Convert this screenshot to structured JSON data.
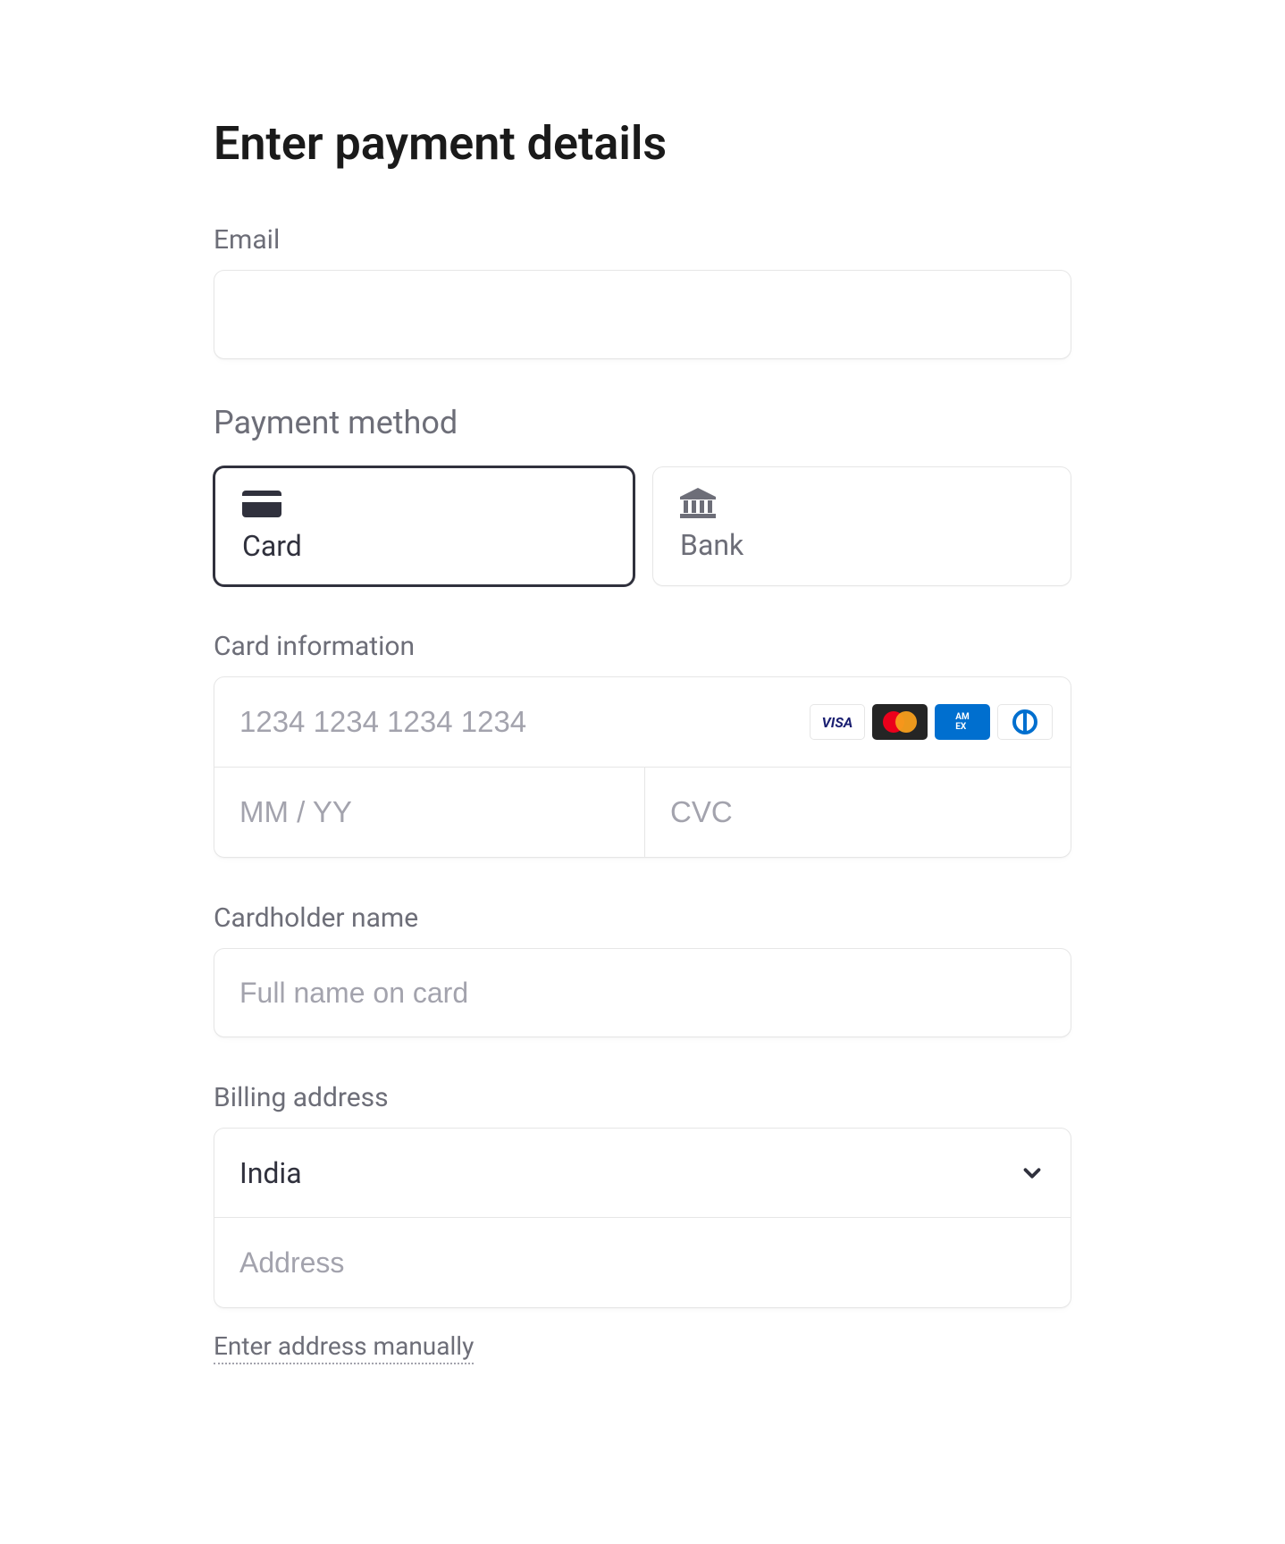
{
  "title": "Enter payment details",
  "email": {
    "label": "Email",
    "value": ""
  },
  "payment_method": {
    "label": "Payment method",
    "options": [
      {
        "id": "card",
        "label": "Card",
        "selected": true
      },
      {
        "id": "bank",
        "label": "Bank",
        "selected": false
      }
    ]
  },
  "card_info": {
    "label": "Card information",
    "number_placeholder": "1234 1234 1234 1234",
    "expiry_placeholder": "MM / YY",
    "cvc_placeholder": "CVC",
    "brands": [
      "visa",
      "mastercard",
      "amex",
      "diners"
    ]
  },
  "cardholder": {
    "label": "Cardholder name",
    "placeholder": "Full name on card"
  },
  "billing": {
    "label": "Billing address",
    "country": "India",
    "address_placeholder": "Address",
    "manual_link": "Enter address manually"
  }
}
